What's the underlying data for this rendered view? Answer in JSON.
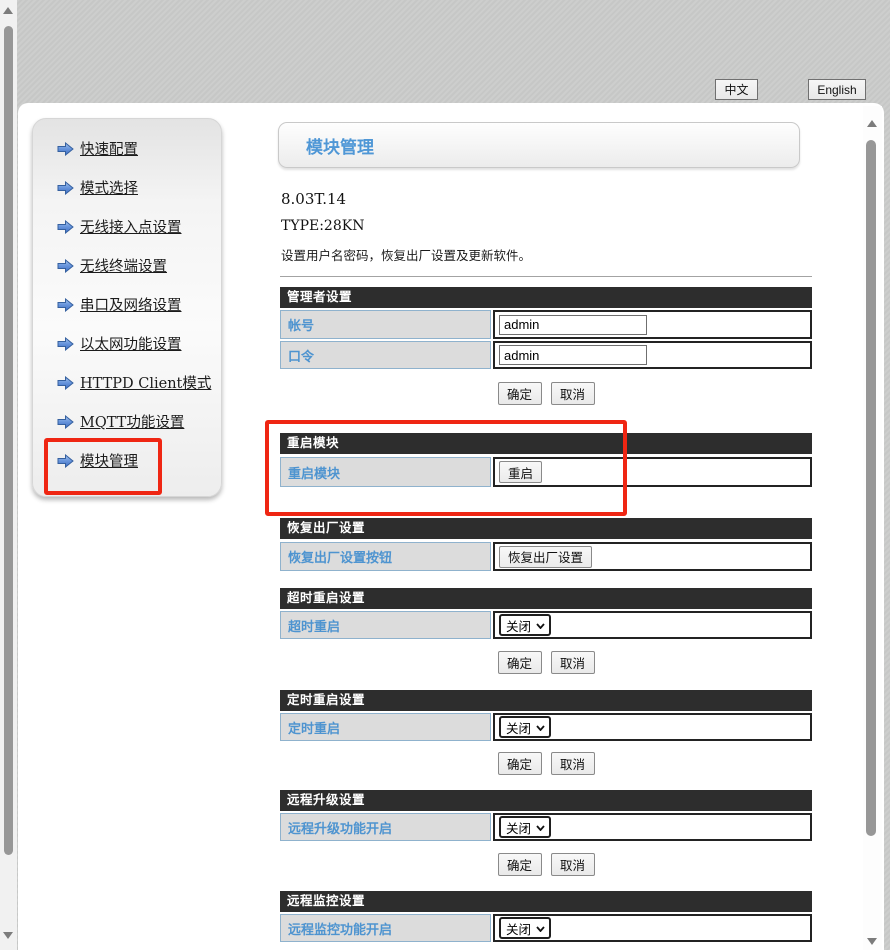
{
  "colors": {
    "accent_blue": "#4f97d6",
    "label_blue": "#4e94d0",
    "highlight_red": "#ef2613",
    "section_header_bg": "#2d2d2d"
  },
  "icons": {
    "sidebar_bullet": "arrow-right-icon",
    "select_chevron": "chevron-down-icon",
    "scroll_up": "triangle-up-icon",
    "scroll_down": "triangle-down-icon"
  },
  "language_bar": {
    "chinese_label": "中文",
    "english_label": "English"
  },
  "sidebar": {
    "items": [
      {
        "label": "快速配置"
      },
      {
        "label": "模式选择"
      },
      {
        "label": "无线接入点设置"
      },
      {
        "label": "无线终端设置"
      },
      {
        "label": "串口及网络设置"
      },
      {
        "label": "以太网功能设置"
      },
      {
        "label": "HTTPD Client模式"
      },
      {
        "label": "MQTT功能设置"
      },
      {
        "label": "模块管理"
      }
    ]
  },
  "page": {
    "title": "模块管理",
    "version": "8.03T.14",
    "type_line": "TYPE:28KN",
    "description": "设置用户名密码，恢复出厂设置及更新软件。"
  },
  "actions": {
    "ok": "确定",
    "cancel": "取消"
  },
  "sections": [
    {
      "header": "管理者设置",
      "rows": [
        {
          "label": "帐号",
          "control": "input",
          "value": "admin"
        },
        {
          "label": "口令",
          "control": "input",
          "value": "admin"
        }
      ]
    },
    {
      "header": "重启模块",
      "rows": [
        {
          "label": "重启模块",
          "control": "button",
          "button_label": "重启"
        }
      ],
      "highlighted": true
    },
    {
      "header": "恢复出厂设置",
      "rows": [
        {
          "label": "恢复出厂设置按钮",
          "control": "button",
          "button_label": "恢复出厂设置"
        }
      ]
    },
    {
      "header": "超时重启设置",
      "rows": [
        {
          "label": "超时重启",
          "control": "select",
          "value": "关闭"
        }
      ]
    },
    {
      "header": "定时重启设置",
      "rows": [
        {
          "label": "定时重启",
          "control": "select",
          "value": "关闭"
        }
      ]
    },
    {
      "header": "远程升级设置",
      "rows": [
        {
          "label": "远程升级功能开启",
          "control": "select",
          "value": "关闭"
        }
      ]
    },
    {
      "header": "远程监控设置",
      "rows": [
        {
          "label": "远程监控功能开启",
          "control": "select",
          "value": "关闭"
        }
      ]
    }
  ]
}
